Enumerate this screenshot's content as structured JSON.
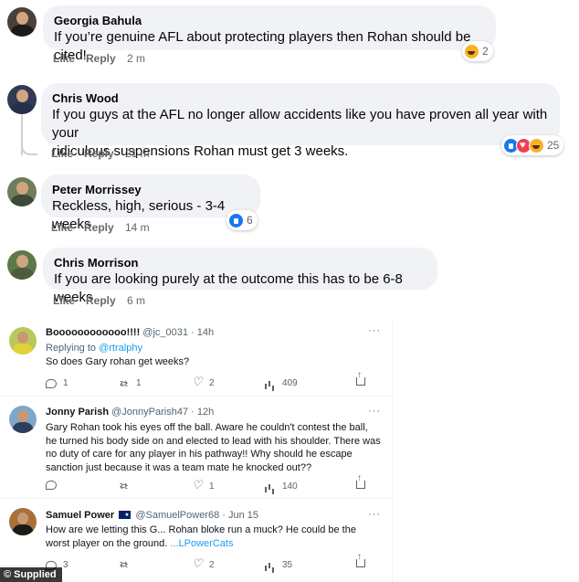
{
  "facebook_comments": [
    {
      "name": "Georgia Bahula",
      "text": "If you’re genuine AFL about protecting players then Rohan should be cited!",
      "like_label": "Like",
      "reply_label": "Reply",
      "time": "2 m",
      "reactions": [
        "haha"
      ],
      "reaction_count": "2"
    },
    {
      "name": "Chris Wood",
      "text_line1": "If you guys at the AFL no longer allow accidents like you have proven all year with your",
      "text_line2": "ridiculous suspensions Rohan must get 3 weeks.",
      "like_label": "Like",
      "reply_label": "Reply",
      "time": "21 m",
      "reactions": [
        "like",
        "love",
        "haha"
      ],
      "reaction_count": "25"
    },
    {
      "name": "Peter Morrissey",
      "text": "Reckless, high, serious - 3-4 weeks",
      "like_label": "Like",
      "reply_label": "Reply",
      "time": "14 m",
      "reactions": [
        "like"
      ],
      "reaction_count": "6"
    },
    {
      "name": "Chris Morrison",
      "text": "If you are looking purely at the outcome this has to be 6-8 weeks",
      "like_label": "Like",
      "reply_label": "Reply",
      "time": "6 m"
    }
  ],
  "tweets": [
    {
      "name": "Boooooooooooo!!!!",
      "handle_time": "@jc_0031 · 14h",
      "more": "···",
      "replying_prefix": "Replying to ",
      "replying_handle": "@rtralphy",
      "text": "So does Gary rohan get weeks?",
      "replies": "1",
      "retweets": "1",
      "likes": "2",
      "views": "409"
    },
    {
      "name": "Jonny Parish",
      "handle_time": "@JonnyParish47 · 12h",
      "more": "···",
      "text_lines": [
        "Gary Rohan took his eyes off the ball. Aware he couldn't contest the ball,",
        "he turned his body side on and elected to lead with his shoulder. There was",
        "no duty of care for any player in his pathway!! Why should he escape",
        "sanction just because it was a team mate he knocked out??"
      ],
      "replies": "",
      "retweets": "",
      "likes": "1",
      "views": "140"
    },
    {
      "name": "Samuel Power",
      "handle_time": "@SamuelPower68 · Jun 15",
      "more": "···",
      "text_line1": "How are we letting this G... Rohan bloke run a muck? He could be the",
      "text_line2_prefix": "worst player on the ground. ",
      "text_line2_link": "...LPowerCats",
      "replies": "3",
      "retweets": "",
      "likes": "2",
      "views": "35"
    }
  ],
  "credit": "© Supplied",
  "colors": {
    "fb_bubble": "#f0f2f5",
    "fb_meta": "#65676b",
    "tw_link": "#1d9bf0",
    "tw_meta": "#536471"
  }
}
